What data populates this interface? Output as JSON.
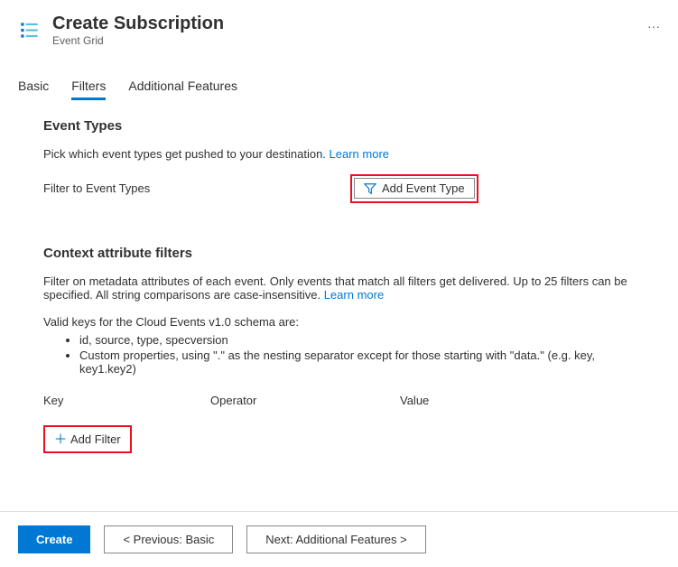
{
  "header": {
    "title": "Create Subscription",
    "subtitle": "Event Grid",
    "more_label": "···"
  },
  "tabs": {
    "items": [
      "Basic",
      "Filters",
      "Additional Features"
    ],
    "active_index": 1
  },
  "event_types": {
    "title": "Event Types",
    "description": "Pick which event types get pushed to your destination. ",
    "learn_more": "Learn more",
    "filter_label": "Filter to Event Types",
    "add_button": "Add Event Type"
  },
  "context_filters": {
    "title": "Context attribute filters",
    "description": "Filter on metadata attributes of each event. Only events that match all filters get delivered. Up to 25 filters can be specified. All string comparisons are case-insensitive. ",
    "learn_more": "Learn more",
    "valid_keys_intro": "Valid keys for the Cloud Events v1.0 schema are:",
    "valid_keys": [
      "id, source, type, specversion",
      "Custom properties, using \".\" as the nesting separator except for those starting with \"data.\" (e.g. key, key1.key2)"
    ],
    "columns": {
      "key": "Key",
      "operator": "Operator",
      "value": "Value"
    },
    "add_filter_button": "Add Filter"
  },
  "footer": {
    "create": "Create",
    "previous": "< Previous: Basic",
    "next": "Next: Additional Features >"
  }
}
